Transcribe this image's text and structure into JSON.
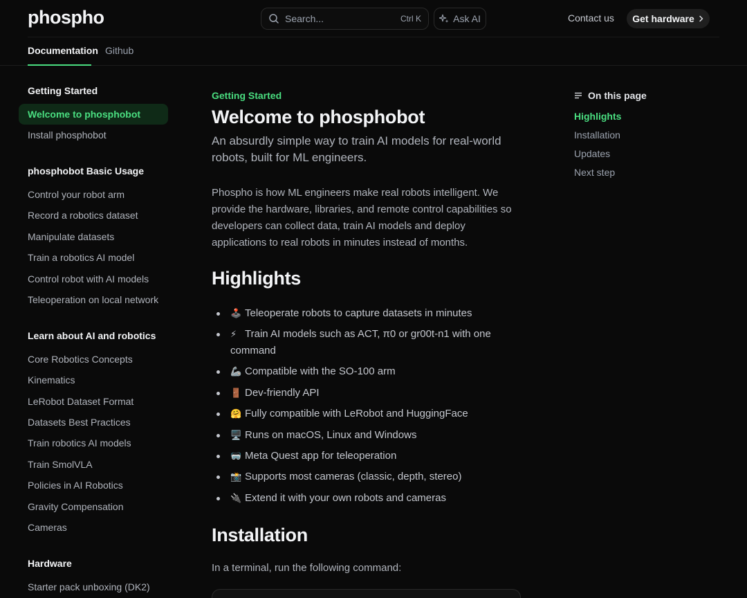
{
  "header": {
    "logo": "phospho",
    "search_placeholder": "Search...",
    "search_shortcut": "Ctrl K",
    "ask_ai": "Ask AI",
    "contact": "Contact us",
    "get_hardware": "Get hardware",
    "tabs": [
      {
        "label": "Documentation",
        "active": true
      },
      {
        "label": "Github",
        "active": false
      }
    ]
  },
  "sidebar": {
    "sections": [
      {
        "title": "Getting Started",
        "items": [
          "Welcome to phosphobot",
          "Install phosphobot"
        ]
      },
      {
        "title": "phosphobot Basic Usage",
        "items": [
          "Control your robot arm",
          "Record a robotics dataset",
          "Manipulate datasets",
          "Train a robotics AI model",
          "Control robot with AI models",
          "Teleoperation on local network"
        ]
      },
      {
        "title": "Learn about AI and robotics",
        "items": [
          "Core Robotics Concepts",
          "Kinematics",
          "LeRobot Dataset Format",
          "Datasets Best Practices",
          "Train robotics AI models",
          "Train SmolVLA",
          "Policies in AI Robotics",
          "Gravity Compensation",
          "Cameras"
        ]
      },
      {
        "title": "Hardware",
        "items": [
          "Starter pack unboxing (DK2)"
        ]
      }
    ],
    "active_item": "Welcome to phosphobot"
  },
  "main": {
    "eyebrow": "Getting Started",
    "title": "Welcome to phosphobot",
    "subtitle": "An absurdly simple way to train AI models for real-world robots, built for ML engineers.",
    "intro": "Phospho is how ML engineers make real robots intelligent. We provide the hardware, libraries, and remote control capabilities so developers can collect data, train AI models and deploy applications to real robots in minutes instead of months.",
    "highlights_heading": "Highlights",
    "highlights": [
      {
        "emoji": "🕹️",
        "text": "Teleoperate robots to capture datasets in minutes"
      },
      {
        "emoji": "⚡",
        "text": "Train AI models such as ACT, π0 or gr00t-n1 with one command"
      },
      {
        "emoji": "🦾",
        "text": "Compatible with the SO-100 arm"
      },
      {
        "emoji": "🚪",
        "text": "Dev-friendly API"
      },
      {
        "emoji": "🤗",
        "text": "Fully compatible with LeRobot and HuggingFace"
      },
      {
        "emoji": "🖥️",
        "text": "Runs on macOS, Linux and Windows"
      },
      {
        "emoji": "🥽",
        "text": "Meta Quest app for teleoperation"
      },
      {
        "emoji": "📸",
        "text": "Supports most cameras (classic, depth, stereo)"
      },
      {
        "emoji": "🔌",
        "text": "Extend it with your own robots and cameras"
      }
    ],
    "installation_heading": "Installation",
    "installation_text": "In a terminal, run the following command:"
  },
  "toc": {
    "title": "On this page",
    "items": [
      "Highlights",
      "Installation",
      "Updates",
      "Next step"
    ],
    "active": "Highlights"
  },
  "colors": {
    "accent": "#4ade80",
    "background": "#0a0a0a"
  }
}
